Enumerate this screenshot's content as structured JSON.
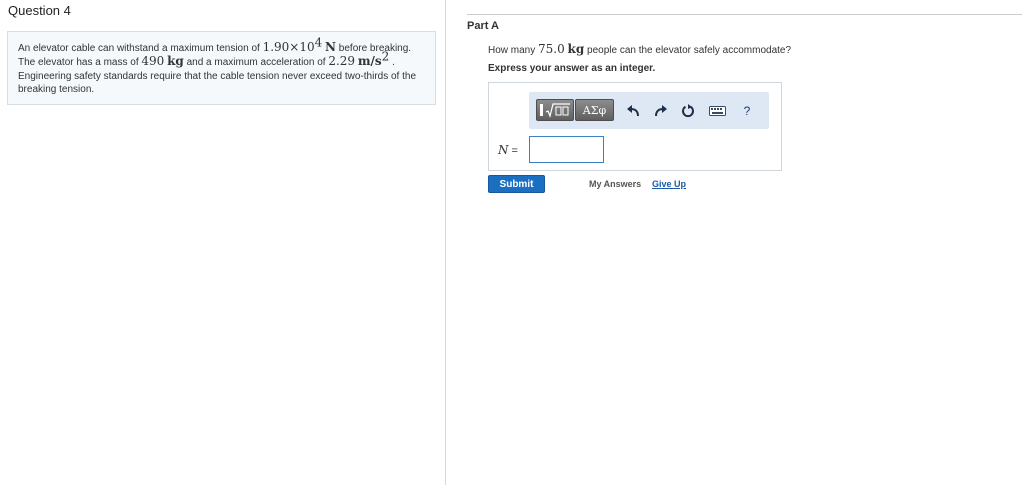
{
  "question": {
    "title": "Question 4",
    "problem": {
      "p1": "An elevator cable can withstand a maximum tension of ",
      "tension_value": "1.90×10",
      "tension_exp": "4",
      "tension_unit": "N",
      "p2": " before breaking. The elevator has a mass of ",
      "mass_value": "490",
      "mass_unit": "kg",
      "p3": " and a maximum acceleration of ",
      "accel_value": "2.29",
      "accel_unit": "m/s",
      "accel_exp": "2",
      "p4": " . Engineering safety standards require that the cable tension never exceed two-thirds of the breaking tension."
    }
  },
  "part": {
    "title": "Part A",
    "question_pre": "How many ",
    "question_value": "75.0",
    "question_unit": "kg",
    "question_post": " people can the elevator safely accommodate?",
    "instruction": "Express your answer as an integer."
  },
  "answer": {
    "toolbar": {
      "symbols_label": "ΑΣφ",
      "undo_icon": "undo-arrow",
      "redo_icon": "redo-arrow",
      "reset_icon": "reset-circle",
      "keyboard_icon": "keyboard",
      "help_label": "?"
    },
    "variable": "N",
    "equals": " =",
    "input_value": ""
  },
  "actions": {
    "submit_label": "Submit",
    "my_answers_label": "My Answers",
    "give_up_label": "Give Up"
  }
}
